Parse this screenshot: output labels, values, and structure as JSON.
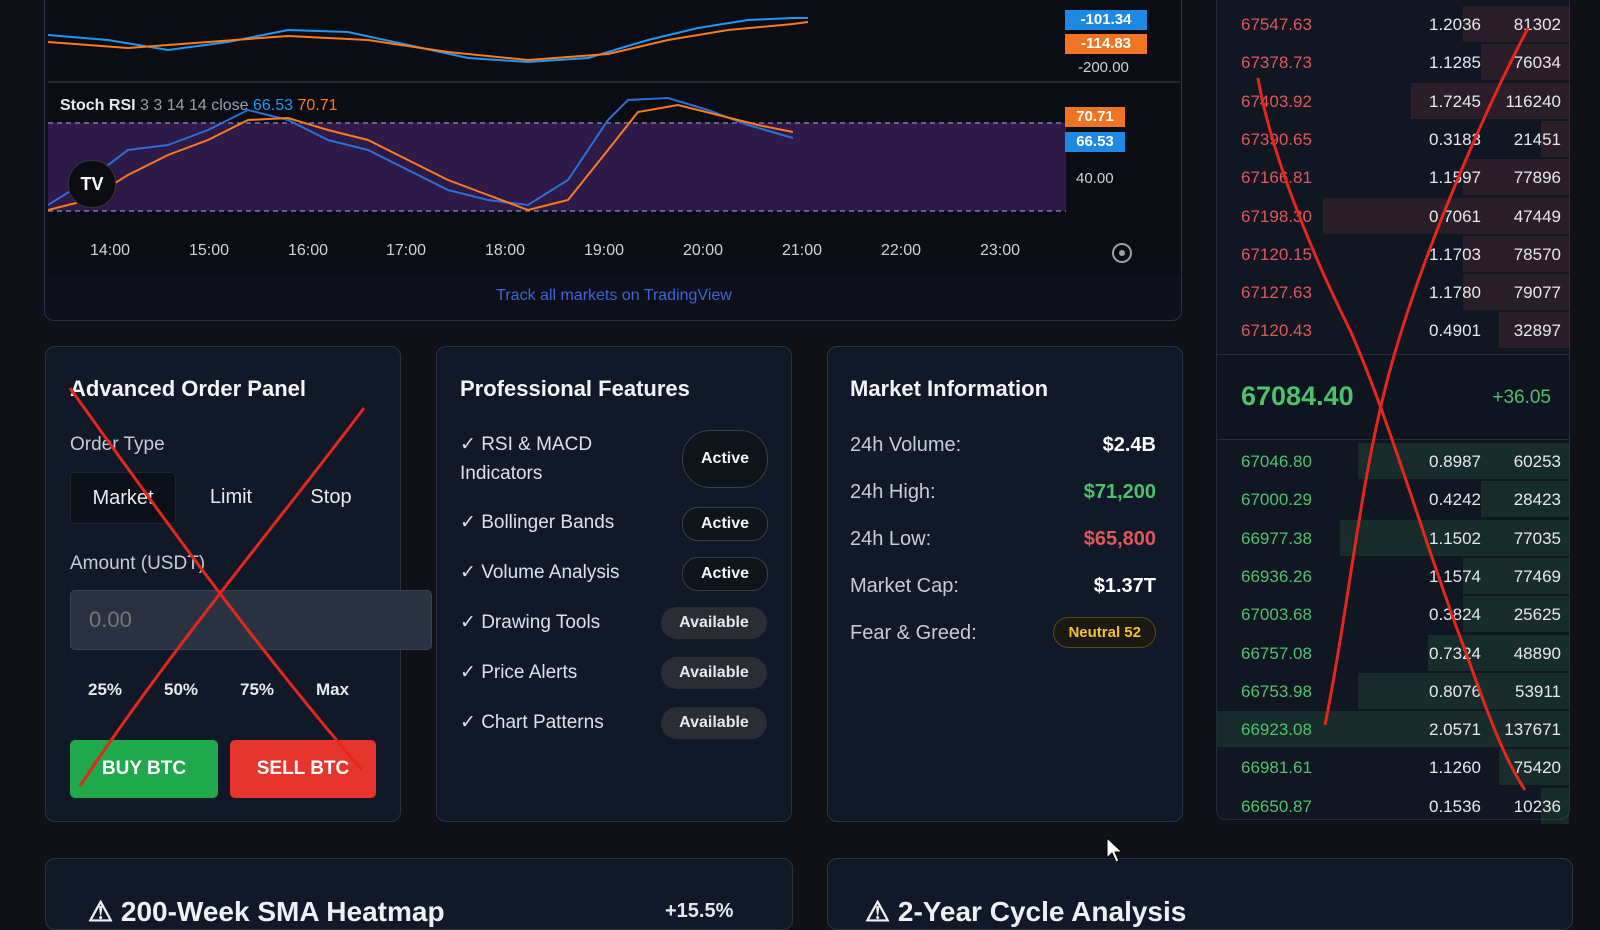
{
  "chart": {
    "macd_tags": [
      "-101.34",
      "-114.83"
    ],
    "macd_axis": "-200.00",
    "stoch_legend_name": "Stoch RSI",
    "stoch_legend_params": "3 3 14 14 close",
    "stoch_k": "66.53",
    "stoch_d": "70.71",
    "stoch_tags": [
      "70.71",
      "66.53"
    ],
    "stoch_axis": "40.00",
    "logo": "TV",
    "time_labels": [
      "14:00",
      "15:00",
      "16:00",
      "17:00",
      "18:00",
      "19:00",
      "20:00",
      "21:00",
      "22:00",
      "23:00"
    ],
    "tradingview_link": "Track all markets on TradingView",
    "colors": {
      "blue": "#2196f3",
      "orange": "#ff7a1a",
      "purple_zone": "#3a1f58"
    }
  },
  "order_panel": {
    "title": "Advanced Order Panel",
    "order_type_label": "Order Type",
    "types": [
      "Market",
      "Limit",
      "Stop"
    ],
    "amount_label": "Amount (USDT)",
    "amount_placeholder": "0.00",
    "percents": [
      "25%",
      "50%",
      "75%",
      "Max"
    ],
    "buy_label": "BUY BTC",
    "sell_label": "SELL BTC"
  },
  "features": {
    "title": "Professional Features",
    "items": [
      {
        "label": "✓ RSI & MACD",
        "label2": "Indicators",
        "status": "Active"
      },
      {
        "label": "✓ Bollinger Bands",
        "status": "Active"
      },
      {
        "label": "✓ Volume Analysis",
        "status": "Active"
      },
      {
        "label": "✓ Drawing Tools",
        "status": "Available"
      },
      {
        "label": "✓ Price Alerts",
        "status": "Available"
      },
      {
        "label": "✓ Chart Patterns",
        "status": "Available"
      }
    ]
  },
  "market_info": {
    "title": "Market Information",
    "rows": [
      {
        "key": "24h Volume:",
        "value": "$2.4B",
        "color": "#ffffff"
      },
      {
        "key": "24h High:",
        "value": "$71,200",
        "color": "#4cc36b"
      },
      {
        "key": "24h Low:",
        "value": "$65,800",
        "color": "#e0575a"
      },
      {
        "key": "Market Cap:",
        "value": "$1.37T",
        "color": "#ffffff"
      },
      {
        "key": "Fear & Greed:",
        "value": "Neutral 52",
        "color": "#f3c02f"
      }
    ]
  },
  "orderbook": {
    "asks": [
      {
        "price": "67547.63",
        "amount": "1.2036",
        "total": "81302",
        "depth": 0.3
      },
      {
        "price": "67378.73",
        "amount": "1.1285",
        "total": "76034",
        "depth": 0.25
      },
      {
        "price": "67403.92",
        "amount": "1.7245",
        "total": "116240",
        "depth": 0.45
      },
      {
        "price": "67390.65",
        "amount": "0.3183",
        "total": "21451",
        "depth": 0.08
      },
      {
        "price": "67166.81",
        "amount": "1.1597",
        "total": "77896",
        "depth": 0.3
      },
      {
        "price": "67198.30",
        "amount": "0.7061",
        "total": "47449",
        "depth": 0.7
      },
      {
        "price": "67120.15",
        "amount": "1.1703",
        "total": "78570",
        "depth": 0.3
      },
      {
        "price": "67127.63",
        "amount": "1.1780",
        "total": "79077",
        "depth": 0.3
      },
      {
        "price": "67120.43",
        "amount": "0.4901",
        "total": "32897",
        "depth": 0.2
      }
    ],
    "mid_price": "67084.40",
    "mid_change": "+36.05",
    "bids": [
      {
        "price": "67046.80",
        "amount": "0.8987",
        "total": "60253",
        "depth": 0.6
      },
      {
        "price": "67000.29",
        "amount": "0.4242",
        "total": "28423",
        "depth": 0.25
      },
      {
        "price": "66977.38",
        "amount": "1.1502",
        "total": "77035",
        "depth": 0.65
      },
      {
        "price": "66936.26",
        "amount": "1.1574",
        "total": "77469",
        "depth": 0.3
      },
      {
        "price": "67003.68",
        "amount": "0.3824",
        "total": "25625",
        "depth": 0.3
      },
      {
        "price": "66757.08",
        "amount": "0.7324",
        "total": "48890",
        "depth": 0.4
      },
      {
        "price": "66753.98",
        "amount": "0.8076",
        "total": "53911",
        "depth": 0.6
      },
      {
        "price": "66923.08",
        "amount": "2.0571",
        "total": "137671",
        "depth": 1.0
      },
      {
        "price": "66981.61",
        "amount": "1.1260",
        "total": "75420",
        "depth": 0.2
      },
      {
        "price": "66650.87",
        "amount": "0.1536",
        "total": "10236",
        "depth": 0.08
      }
    ],
    "ask_color": "#e0575a",
    "bid_color": "#4cc36b"
  },
  "bottom": {
    "left_title": "⚠ 200-Week SMA Heatmap",
    "left_value": "+15.5%",
    "right_title": "⚠ 2-Year Cycle Analysis"
  }
}
